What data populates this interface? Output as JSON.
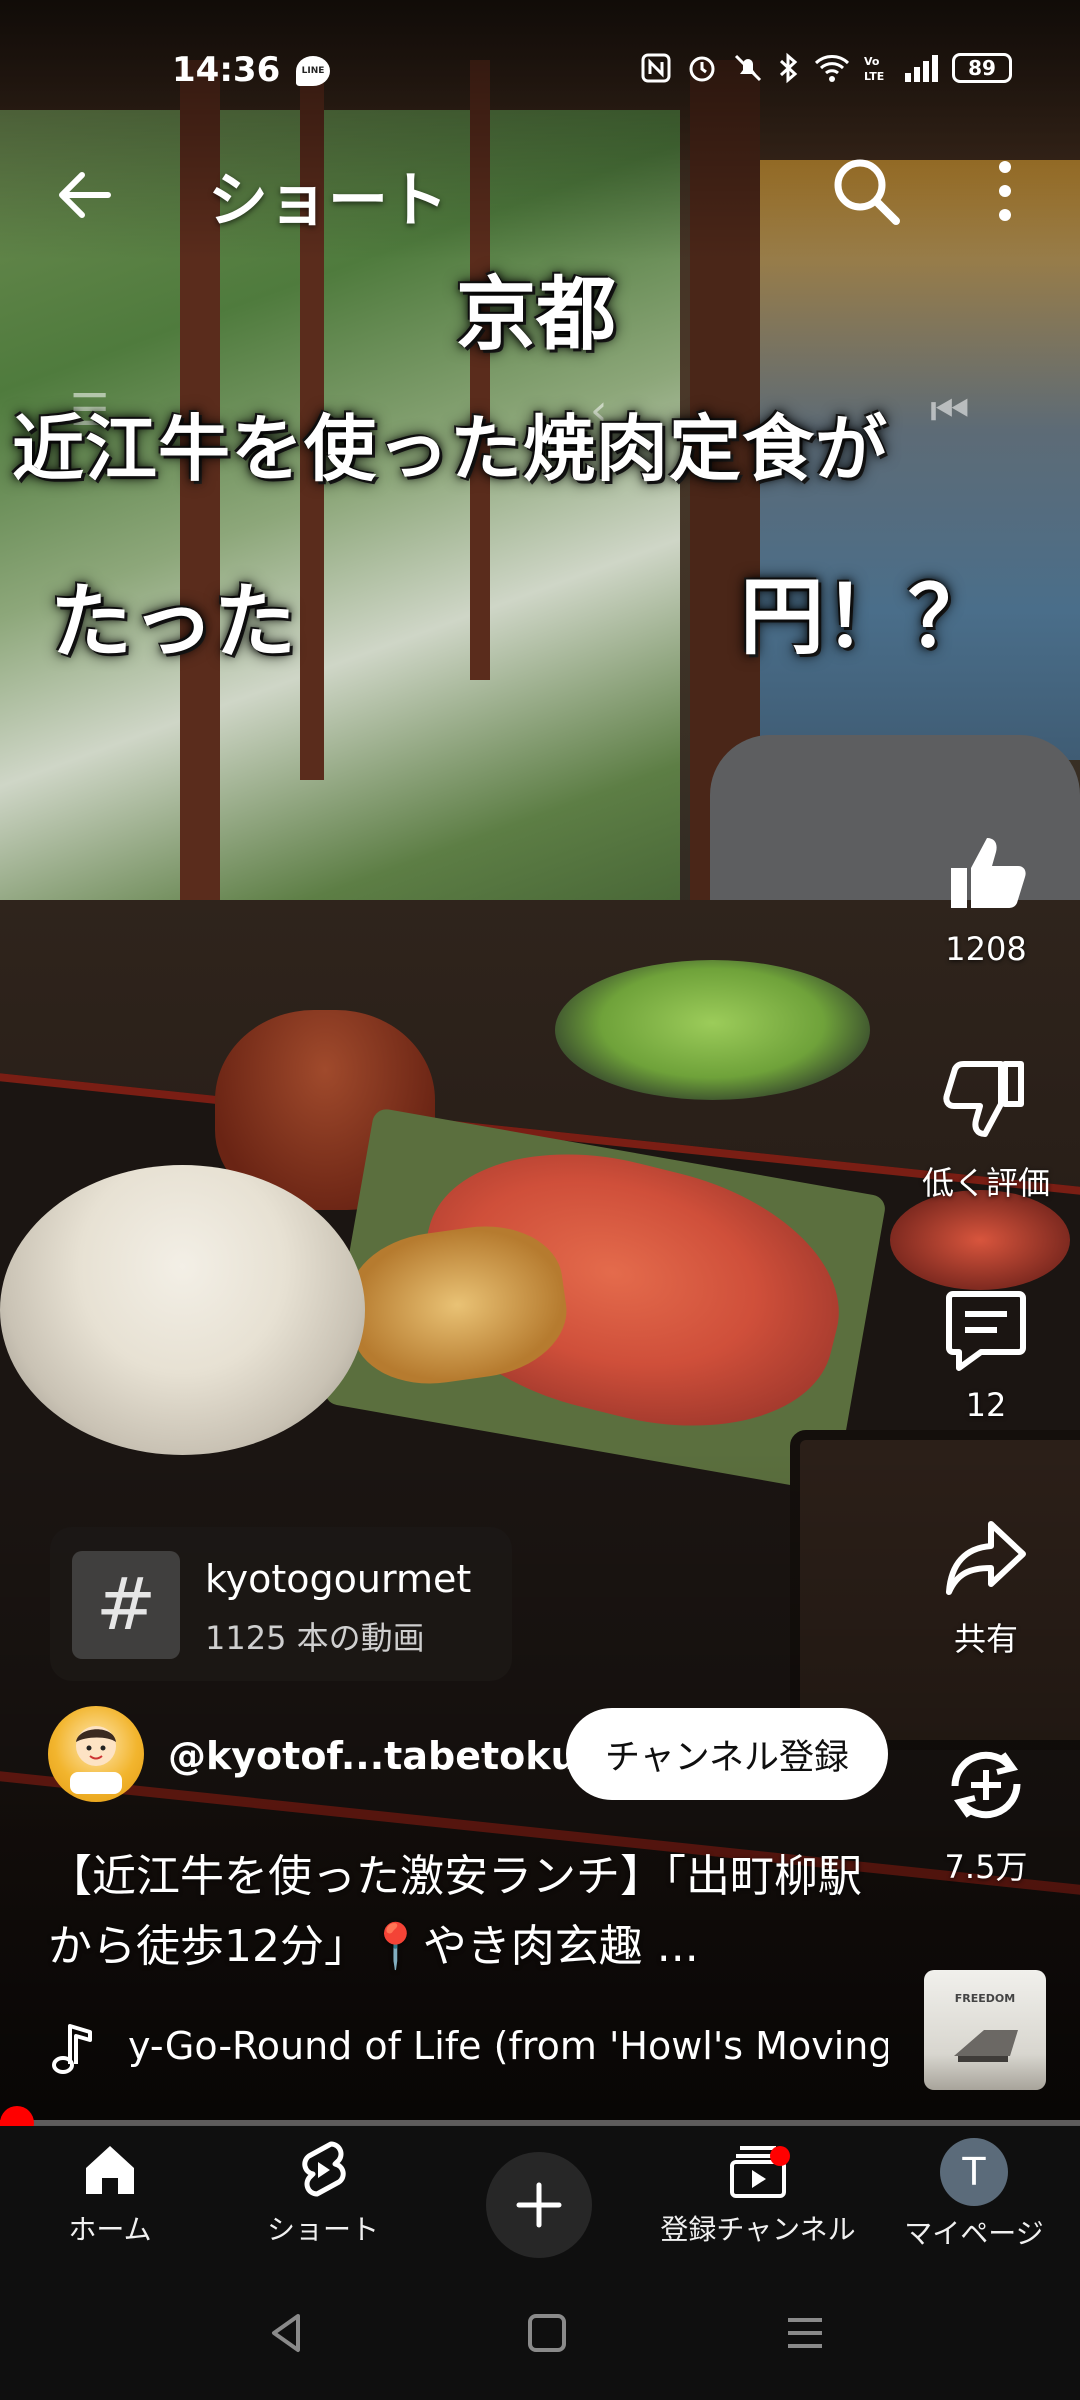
{
  "status_bar": {
    "time": "14:36",
    "battery": "89"
  },
  "app_bar": {
    "title": "ショート"
  },
  "captions": {
    "line1": "京都",
    "line2": "近江牛を使った焼肉定食が",
    "line3a": "たった",
    "line3b": "円！？"
  },
  "actions": {
    "like_count": "1208",
    "dislike_label": "低く評価",
    "comment_count": "12",
    "share_label": "共有",
    "remix_count": "7.5万"
  },
  "hashtag": {
    "name": "kyotogourmet",
    "count": "1125 本の動画"
  },
  "channel": {
    "handle": "@kyotof...tabetoku",
    "subscribe_label": "チャンネル登録"
  },
  "description": "【近江牛を使った激安ランチ】「出町柳駅から徒歩12分」📍やき肉玄趣 ...",
  "music": {
    "title": "y-Go-Round of Life (from 'Howl's Moving",
    "album_text": "FREEDOM"
  },
  "progress": {
    "fraction": 0.01
  },
  "nav": {
    "home": "ホーム",
    "shorts": "ショート",
    "subscriptions": "登録チャンネル",
    "mypage": "マイページ",
    "profile_initial": "T"
  },
  "colors": {
    "accent": "#ff0000",
    "nav_bg": "#0f0f0f"
  }
}
